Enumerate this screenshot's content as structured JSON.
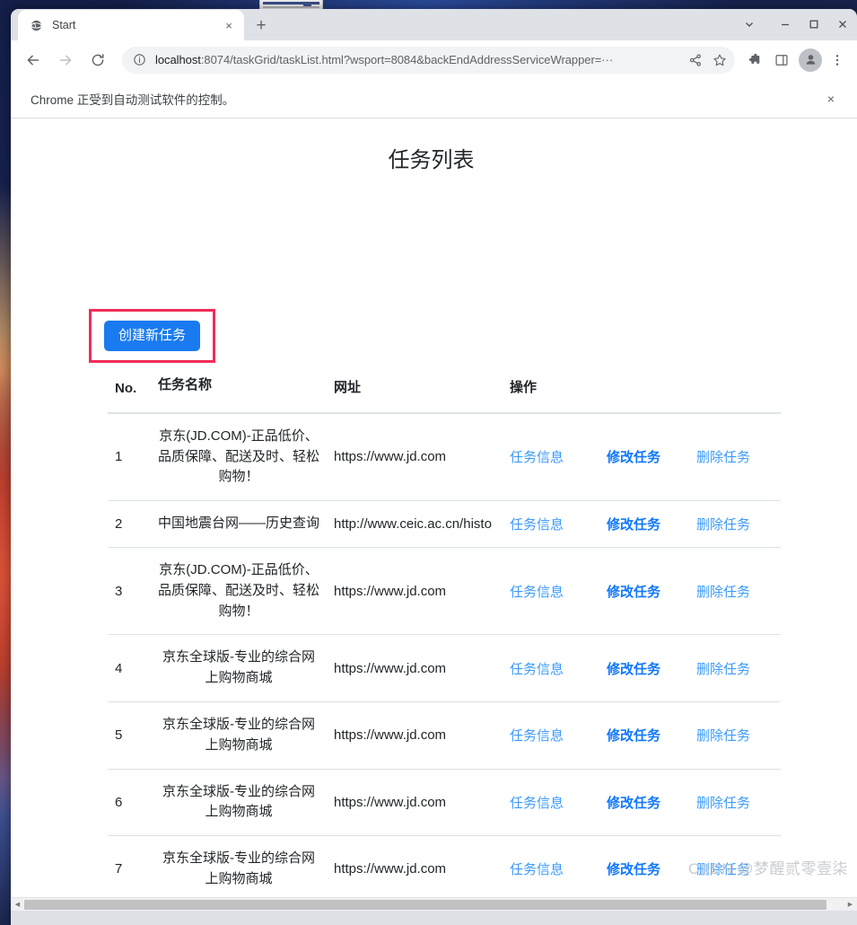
{
  "browser": {
    "tab": {
      "title": "Start",
      "favicon": "globe-icon",
      "close_label": "×"
    },
    "new_tab_label": "+",
    "window_controls": {
      "chevron": "⌄",
      "minimize": "–",
      "maximize": "□",
      "close": "×"
    },
    "toolbar": {
      "back": "←",
      "forward": "→",
      "reload": "↻",
      "url_host": "localhost",
      "url_rest": ":8074/taskGrid/taskList.html?wsport=8084&backEndAddressServiceWrapper=···",
      "url_full": "localhost:8074/taskGrid/taskList.html?wsport=8084&backEndAddressServiceWrapper=···",
      "share_icon": "share-icon",
      "bookmark_icon": "star-icon",
      "extensions_icon": "puzzle-icon",
      "side_panel_icon": "side-panel-icon",
      "profile_icon": "profile-avatar-icon",
      "menu_icon": "three-dot-menu-icon"
    },
    "infobar": {
      "message": "Chrome 正受到自动测试软件的控制。",
      "close_label": "×"
    }
  },
  "page": {
    "title": "任务列表",
    "create_button": "创建新任务",
    "highlight_color": "#ef2d56",
    "button_color": "#1a7bf0",
    "table": {
      "headers": [
        "No.",
        "任务名称",
        "网址",
        "操作"
      ],
      "actions": {
        "info": "任务信息",
        "edit": "修改任务",
        "delete": "删除任务"
      },
      "action_colors": {
        "info": "#3d9bfa",
        "edit": "#1178fb",
        "delete": "#3d9bfa"
      },
      "rows": [
        {
          "no": "1",
          "name": "京东(JD.COM)-正品低价、品质保障、配送及时、轻松购物！",
          "url": "https://www.jd.com"
        },
        {
          "no": "2",
          "name": "中国地震台网——历史查询",
          "url": "http://www.ceic.ac.cn/histo"
        },
        {
          "no": "3",
          "name": "京东(JD.COM)-正品低价、品质保障、配送及时、轻松购物！",
          "url": "https://www.jd.com"
        },
        {
          "no": "4",
          "name": "京东全球版-专业的综合网上购物商城",
          "url": "https://www.jd.com"
        },
        {
          "no": "5",
          "name": "京东全球版-专业的综合网上购物商城",
          "url": "https://www.jd.com"
        },
        {
          "no": "6",
          "name": "京东全球版-专业的综合网上购物商城",
          "url": "https://www.jd.com"
        },
        {
          "no": "7",
          "name": "京东全球版-专业的综合网上购物商城",
          "url": "https://www.jd.com"
        }
      ]
    },
    "watermark": "CSDN @梦醒贰零壹柒"
  },
  "scrollbar": {
    "left_arrow": "◀",
    "right_arrow": "▶"
  }
}
